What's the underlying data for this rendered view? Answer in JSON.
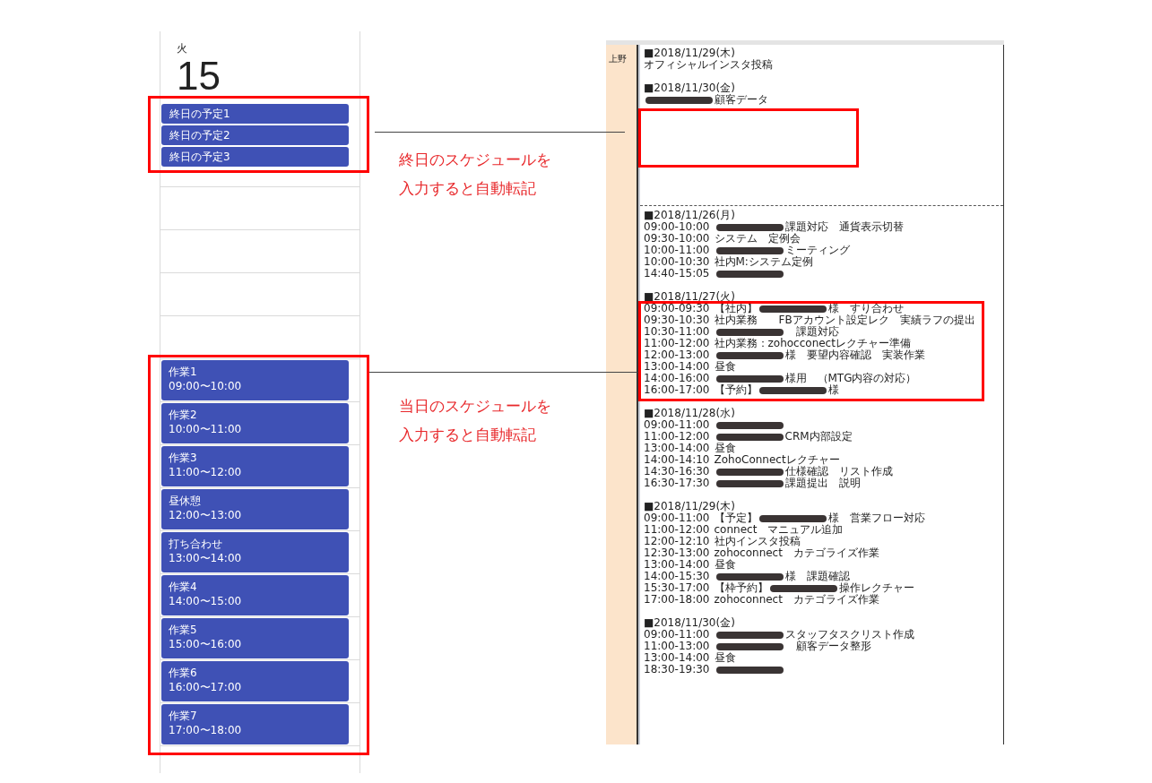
{
  "calendar": {
    "weekday": "火",
    "day": "15",
    "all_day_events": [
      {
        "title": "終日の予定1"
      },
      {
        "title": "終日の予定2"
      },
      {
        "title": "終日の予定3"
      }
    ],
    "timed_events": [
      {
        "title": "作業1",
        "time": "09:00〜10:00"
      },
      {
        "title": "作業2",
        "time": "10:00〜11:00"
      },
      {
        "title": "作業3",
        "time": "11:00〜12:00"
      },
      {
        "title": "昼休憩",
        "time": "12:00〜13:00"
      },
      {
        "title": "打ち合わせ",
        "time": "13:00〜14:00"
      },
      {
        "title": "作業4",
        "time": "14:00〜15:00"
      },
      {
        "title": "作業5",
        "time": "15:00〜16:00"
      },
      {
        "title": "作業6",
        "time": "16:00〜17:00"
      },
      {
        "title": "作業7",
        "time": "17:00〜18:00"
      }
    ]
  },
  "annotations": [
    {
      "lines": [
        "終日のスケジュールを",
        "入力すると自動転記"
      ]
    },
    {
      "lines": [
        "当日のスケジュールを",
        "入力すると自動転記"
      ]
    }
  ],
  "sheet": {
    "name": "上野",
    "cells": [
      {
        "days": [
          {
            "date": "■2018/11/29(木)",
            "entries": [
              {
                "parts": [
                  {
                    "kind": "text",
                    "text": "オフィシャルインスタ投稿"
                  }
                ]
              }
            ]
          },
          {
            "date": "■2018/11/30(金)",
            "entries": [
              {
                "parts": [
                  {
                    "kind": "redacted"
                  },
                  {
                    "kind": "text",
                    "text": "顧客データ"
                  }
                ]
              }
            ]
          }
        ]
      },
      {
        "days": [
          {
            "date": "■2018/11/26(月)",
            "entries": [
              {
                "time": "09:00-10:00",
                "parts": [
                  {
                    "kind": "redacted"
                  },
                  {
                    "kind": "text",
                    "text": "課題対応　通貨表示切替"
                  }
                ]
              },
              {
                "time": "09:30-10:00",
                "parts": [
                  {
                    "kind": "text",
                    "text": "システム　定例会"
                  }
                ]
              },
              {
                "time": "10:00-11:00",
                "parts": [
                  {
                    "kind": "redacted"
                  },
                  {
                    "kind": "text",
                    "text": "ミーティング"
                  }
                ]
              },
              {
                "time": "10:00-10:30",
                "parts": [
                  {
                    "kind": "text",
                    "text": "社内M:システム定例"
                  }
                ]
              },
              {
                "time": "14:40-15:05",
                "parts": [
                  {
                    "kind": "redacted"
                  }
                ]
              }
            ]
          },
          {
            "date": "■2018/11/27(火)",
            "entries": [
              {
                "time": "09:00-09:30",
                "parts": [
                  {
                    "kind": "text",
                    "text": "【社内】"
                  },
                  {
                    "kind": "redacted"
                  },
                  {
                    "kind": "text",
                    "text": "様　すり合わせ"
                  }
                ]
              },
              {
                "time": "09:30-10:30",
                "parts": [
                  {
                    "kind": "text",
                    "text": "社内業務　　FBアカウント設定レク　実績ラフの提出"
                  }
                ]
              },
              {
                "time": "10:30-11:00",
                "parts": [
                  {
                    "kind": "redacted"
                  },
                  {
                    "kind": "text",
                    "text": "　課題対応"
                  }
                ]
              },
              {
                "time": "11:00-12:00",
                "parts": [
                  {
                    "kind": "text",
                    "text": "社内業務：zohocconectレクチャー準備"
                  }
                ]
              },
              {
                "time": "12:00-13:00",
                "parts": [
                  {
                    "kind": "redacted"
                  },
                  {
                    "kind": "text",
                    "text": "様　要望内容確認　実装作業"
                  }
                ]
              },
              {
                "time": "13:00-14:00",
                "parts": [
                  {
                    "kind": "text",
                    "text": "昼食"
                  }
                ]
              },
              {
                "time": "14:00-16:00",
                "parts": [
                  {
                    "kind": "redacted"
                  },
                  {
                    "kind": "text",
                    "text": "様用　（MTG内容の対応）"
                  }
                ]
              },
              {
                "time": "16:00-17:00",
                "parts": [
                  {
                    "kind": "text",
                    "text": "【予約】"
                  },
                  {
                    "kind": "redacted"
                  },
                  {
                    "kind": "text",
                    "text": "様"
                  }
                ]
              }
            ]
          },
          {
            "date": "■2018/11/28(水)",
            "entries": [
              {
                "time": "09:00-11:00",
                "parts": [
                  {
                    "kind": "redacted"
                  }
                ]
              },
              {
                "time": "11:00-12:00",
                "parts": [
                  {
                    "kind": "redacted"
                  },
                  {
                    "kind": "text",
                    "text": "CRM内部設定"
                  }
                ]
              },
              {
                "time": "13:00-14:00",
                "parts": [
                  {
                    "kind": "text",
                    "text": "昼食"
                  }
                ]
              },
              {
                "time": "14:00-14:10",
                "parts": [
                  {
                    "kind": "text",
                    "text": "ZohoConnectレクチャー"
                  }
                ]
              },
              {
                "time": "14:30-16:30",
                "parts": [
                  {
                    "kind": "redacted"
                  },
                  {
                    "kind": "text",
                    "text": "仕様確認　リスト作成"
                  }
                ]
              },
              {
                "time": "16:30-17:30",
                "parts": [
                  {
                    "kind": "redacted"
                  },
                  {
                    "kind": "text",
                    "text": "課題提出　説明"
                  }
                ]
              }
            ]
          },
          {
            "date": "■2018/11/29(木)",
            "entries": [
              {
                "time": "09:00-11:00",
                "parts": [
                  {
                    "kind": "text",
                    "text": "【予定】"
                  },
                  {
                    "kind": "redacted"
                  },
                  {
                    "kind": "text",
                    "text": "様　営業フロー対応"
                  }
                ]
              },
              {
                "time": "11:00-12:00",
                "parts": [
                  {
                    "kind": "text",
                    "text": "connect　マニュアル追加"
                  }
                ]
              },
              {
                "time": "12:00-12:10",
                "parts": [
                  {
                    "kind": "text",
                    "text": "社内インスタ投稿"
                  }
                ]
              },
              {
                "time": "12:30-13:00",
                "parts": [
                  {
                    "kind": "text",
                    "text": "zohoconnect　カテゴライズ作業"
                  }
                ]
              },
              {
                "time": "13:00-14:00",
                "parts": [
                  {
                    "kind": "text",
                    "text": "昼食"
                  }
                ]
              },
              {
                "time": "14:00-15:30",
                "parts": [
                  {
                    "kind": "redacted"
                  },
                  {
                    "kind": "text",
                    "text": "様　課題確認"
                  }
                ]
              },
              {
                "time": "15:30-17:00",
                "parts": [
                  {
                    "kind": "text",
                    "text": "【枠予約】"
                  },
                  {
                    "kind": "redacted"
                  },
                  {
                    "kind": "text",
                    "text": "操作レクチャー"
                  }
                ]
              },
              {
                "time": "17:00-18:00",
                "parts": [
                  {
                    "kind": "text",
                    "text": "zohoconnect　カテゴライズ作業"
                  }
                ]
              }
            ]
          },
          {
            "date": "■2018/11/30(金)",
            "entries": [
              {
                "time": "09:00-11:00",
                "parts": [
                  {
                    "kind": "redacted"
                  },
                  {
                    "kind": "text",
                    "text": "スタッフタスクリスト作成"
                  }
                ]
              },
              {
                "time": "11:00-13:00",
                "parts": [
                  {
                    "kind": "redacted"
                  },
                  {
                    "kind": "text",
                    "text": "　顧客データ整形"
                  }
                ]
              },
              {
                "time": "13:00-14:00",
                "parts": [
                  {
                    "kind": "text",
                    "text": "昼食"
                  }
                ]
              },
              {
                "time": "18:30-19:30",
                "parts": [
                  {
                    "kind": "redacted"
                  }
                ]
              }
            ]
          }
        ]
      }
    ]
  }
}
